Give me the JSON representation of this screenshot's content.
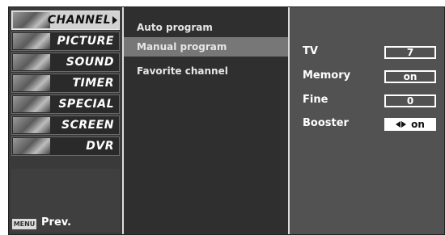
{
  "menu": {
    "items": [
      {
        "label": "CHANNEL",
        "icon": "channel-thumbnail"
      },
      {
        "label": "PICTURE",
        "icon": "picture-thumbnail"
      },
      {
        "label": "SOUND",
        "icon": "sound-thumbnail"
      },
      {
        "label": "TIMER",
        "icon": "timer-thumbnail"
      },
      {
        "label": "SPECIAL",
        "icon": "special-thumbnail"
      },
      {
        "label": "SCREEN",
        "icon": "screen-thumbnail"
      },
      {
        "label": "DVR",
        "icon": "dvr-thumbnail"
      }
    ],
    "selected": "CHANNEL",
    "footer": {
      "key": "MENU",
      "label": "Prev."
    }
  },
  "submenu": {
    "items": [
      "Auto program",
      "Manual program",
      "Favorite channel"
    ],
    "selected": "Manual program"
  },
  "settings": {
    "rows": [
      {
        "label": "TV",
        "value": "7"
      },
      {
        "label": "Memory",
        "value": "on"
      },
      {
        "label": "Fine",
        "value": "0"
      },
      {
        "label": "Booster",
        "value": "on",
        "active": true
      }
    ]
  }
}
